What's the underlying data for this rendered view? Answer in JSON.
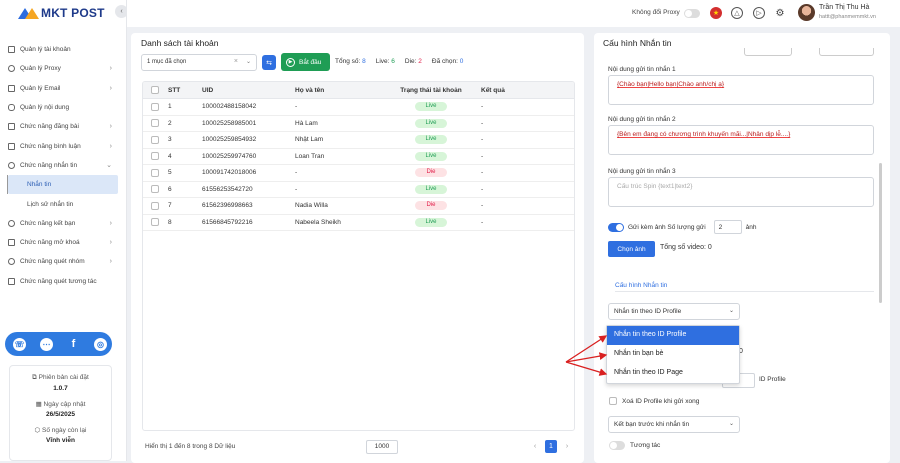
{
  "brand": {
    "name": "MKT POST",
    "collapse_icon": "chevron-left-icon"
  },
  "sidebar": {
    "items": [
      {
        "label": "Quản lý tài khoản",
        "icon": "grid-icon",
        "chevron": ""
      },
      {
        "label": "Quản lý Proxy",
        "icon": "globe-icon",
        "chevron": "›"
      },
      {
        "label": "Quản lý Email",
        "icon": "mail-icon",
        "chevron": "›"
      },
      {
        "label": "Quản lý nội dung",
        "icon": "link-icon",
        "chevron": ""
      },
      {
        "label": "Chức năng đăng bài",
        "icon": "edit-icon",
        "chevron": "›"
      },
      {
        "label": "Chức năng bình luận",
        "icon": "comment-icon",
        "chevron": "›"
      },
      {
        "label": "Chức năng nhắn tin",
        "icon": "message-icon",
        "chevron": "⌄"
      },
      {
        "label": "Nhắn tin",
        "icon": "",
        "chevron": ""
      },
      {
        "label": "Lịch sử nhắn tin",
        "icon": "",
        "chevron": ""
      },
      {
        "label": "Chức năng kết bạn",
        "icon": "user-add-icon",
        "chevron": "›"
      },
      {
        "label": "Chức năng mở khoá",
        "icon": "lock-icon",
        "chevron": "›"
      },
      {
        "label": "Chức năng quét nhóm",
        "icon": "group-icon",
        "chevron": "›"
      },
      {
        "label": "Chức năng quét tương tác",
        "icon": "list-icon",
        "chevron": ""
      }
    ]
  },
  "social": {
    "icons": [
      "support-icon",
      "messenger-icon",
      "facebook-icon",
      "web-icon"
    ],
    "fb_glyph": "f"
  },
  "version_info": {
    "version_label": "Phiên bản cài đặt",
    "version_value": "1.0.7",
    "update_label": "Ngày cập nhật",
    "update_value": "26/5/2025",
    "days_label": "Số ngày còn lại",
    "days_value": "Vĩnh viễn"
  },
  "topbar": {
    "proxy_label": "Không đổi Proxy",
    "user_name": "Trần Thị Thu Hà",
    "user_email": "hattt@phanmemmkt.vn"
  },
  "accounts": {
    "title": "Danh sách tài khoản",
    "select_value": "1 mục đã chọn",
    "start_label": "Bắt đầu",
    "total_label": "Tổng số:",
    "total_value": "8",
    "live_label": "Live:",
    "live_value": "6",
    "die_label": "Die:",
    "die_value": "2",
    "selected_label": "Đã chọn:",
    "selected_value": "0",
    "columns": [
      "STT",
      "UID",
      "Họ và tên",
      "Trạng thái tài khoản",
      "Kết quả"
    ],
    "rows": [
      {
        "stt": "1",
        "uid": "100002488158042",
        "name": "-",
        "status": "Live",
        "result": "-"
      },
      {
        "stt": "2",
        "uid": "100025258985001",
        "name": "Hà Lam",
        "status": "Live",
        "result": "-"
      },
      {
        "stt": "3",
        "uid": "100025259854932",
        "name": "Nhật Lam",
        "status": "Live",
        "result": "-"
      },
      {
        "stt": "4",
        "uid": "100025259974760",
        "name": "Loan Tran",
        "status": "Live",
        "result": "-"
      },
      {
        "stt": "5",
        "uid": "100091742018006",
        "name": "-",
        "status": "Die",
        "result": "-"
      },
      {
        "stt": "6",
        "uid": "61556253542720",
        "name": "-",
        "status": "Live",
        "result": "-"
      },
      {
        "stt": "7",
        "uid": "61562396998663",
        "name": "Nadia Willa",
        "status": "Die",
        "result": "-"
      },
      {
        "stt": "8",
        "uid": "61566845792216",
        "name": "Nabeela Sheikh",
        "status": "Live",
        "result": "-"
      }
    ],
    "footer": "Hiển thị 1 đến 8 trong 8 Dữ liệu",
    "page_size": "1000",
    "current_page": "1"
  },
  "messaging": {
    "title": "Cấu hình Nhắn tin",
    "msg1_label": "Nội dung gửi tin nhắn 1",
    "msg1_value": "{Chào bạn|Hello bạn|Chào anh/chị ạ}",
    "msg2_label": "Nội dung gửi tin nhắn 2",
    "msg2_value": "{Bên em đang có chương trình khuyến mãi...|Nhân dịp lễ....}",
    "msg3_label": "Nội dung gửi tin nhắn 3",
    "msg3_placeholder": "Cấu trúc Spin {text1|text2}",
    "attach_label": "Gửi kèm ảnh Số lượng gửi",
    "attach_count": "2",
    "attach_unit": "ảnh",
    "choose_image": "Chọn ảnh",
    "video_count": "Tổng số video: 0",
    "config_header": "Cấu hình Nhắn tin",
    "mode_value": "Nhắn tin theo ID Profile",
    "mode_options": [
      "Nhắn tin theo ID Profile",
      "Nhắn tin bạn bè",
      "Nhắn tin theo ID Page"
    ],
    "behind_value": "0",
    "id_profile_label": "ID Profile",
    "delete_label": "Xoá ID Profile khi gửi xong",
    "friend_value": "Kết bạn trước khi nhắn tin",
    "interact_label": "Tương tác"
  },
  "colors": {
    "primary": "#2f6fe0",
    "success": "#1f9d55",
    "danger": "#e11d48",
    "arrow": "#d92020"
  }
}
